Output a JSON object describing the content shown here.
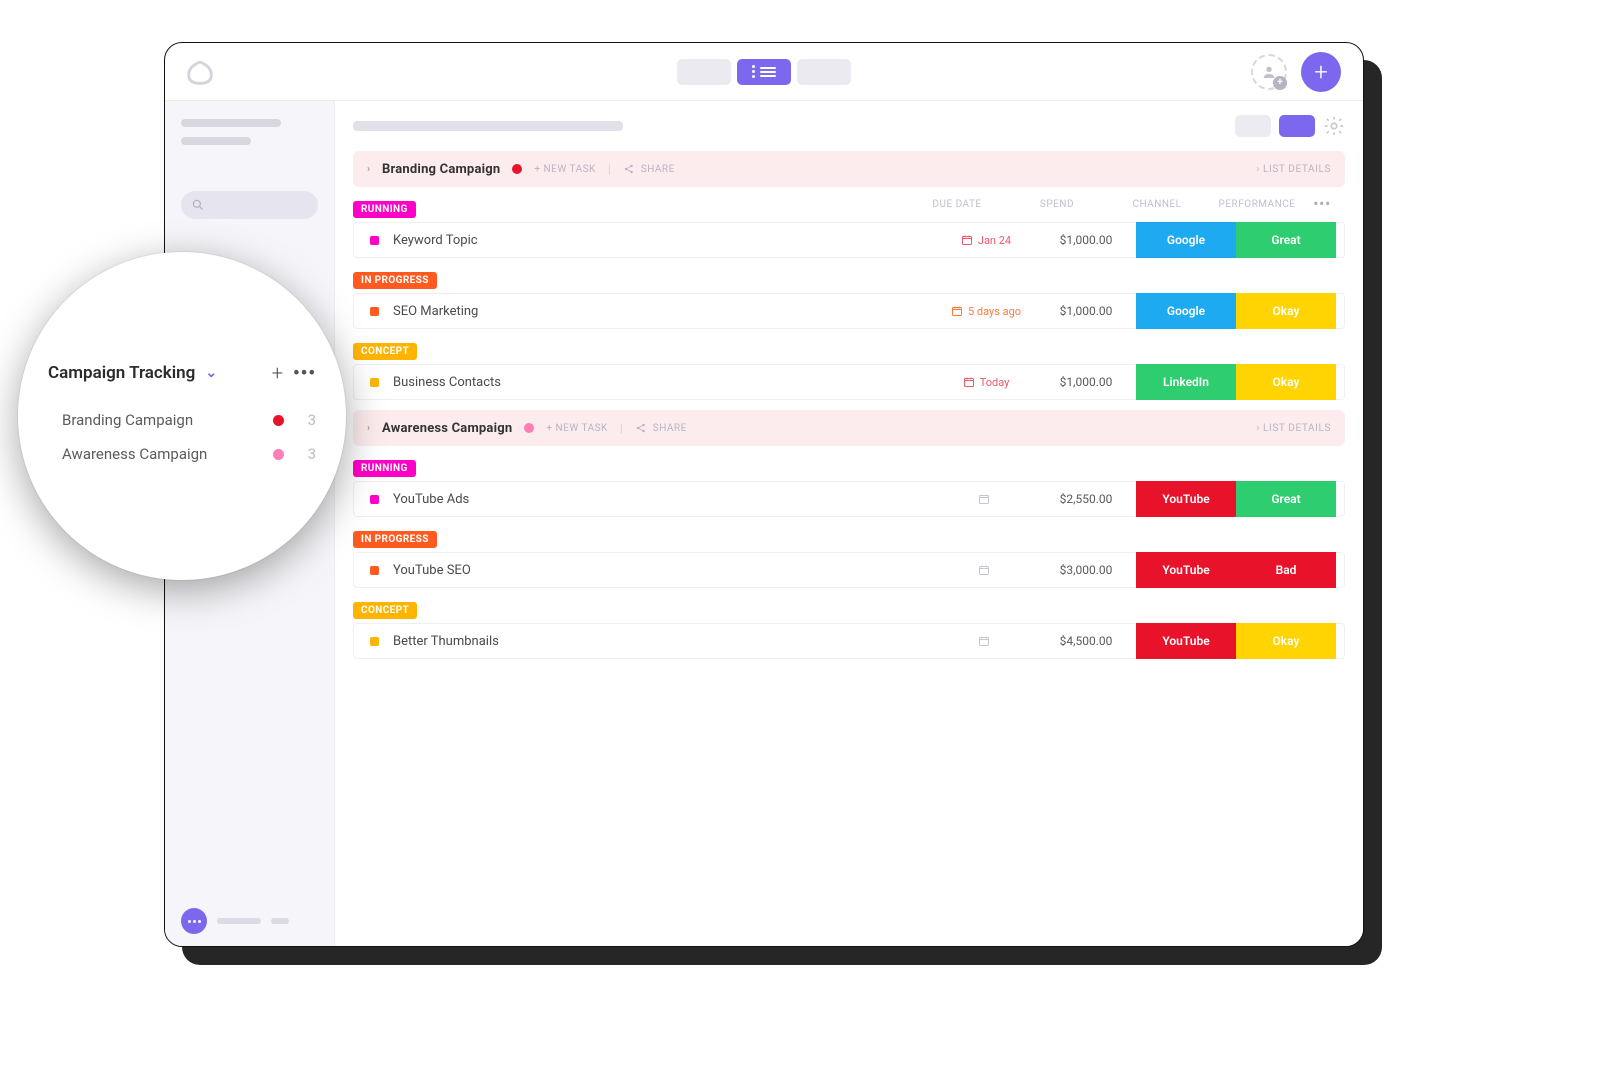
{
  "colors": {
    "accent": "#7b68ee",
    "magenta": "#ff00c7",
    "orange": "#ff5a1f",
    "amber": "#ffb400",
    "blue": "#1eaaf1",
    "green": "#2ecd6f",
    "yellow": "#ffd400",
    "red": "#e8132a",
    "pink": "#ff7eb6"
  },
  "zoom": {
    "title": "Campaign Tracking",
    "items": [
      {
        "label": "Branding Campaign",
        "dot_color": "#e8132a",
        "count": "3"
      },
      {
        "label": "Awareness Campaign",
        "dot_color": "#ff7eb6",
        "count": "3"
      }
    ]
  },
  "columns": {
    "due": "DUE DATE",
    "spend": "SPEND",
    "channel": "CHANNEL",
    "performance": "PERFORMANCE"
  },
  "group_actions": {
    "new_task": "+ NEW TASK",
    "share": "SHARE",
    "list_details": "LIST DETAILS"
  },
  "groups": [
    {
      "title": "Branding Campaign",
      "dot_color": "#e8132a",
      "header_bg": "pink-light",
      "show_column_headers": true,
      "sections": [
        {
          "status_label": "RUNNING",
          "status_color": "c-magenta",
          "tasks": [
            {
              "square_color": "c-magenta",
              "name": "Keyword Topic",
              "due_text": "Jan 24",
              "due_class": "due-red",
              "due_icon": true,
              "spend": "$1,000.00",
              "channel": "Google",
              "channel_color": "c-blue",
              "performance": "Great",
              "performance_color": "c-green"
            }
          ]
        },
        {
          "status_label": "IN PROGRESS",
          "status_color": "c-orange",
          "tasks": [
            {
              "square_color": "c-orange",
              "name": "SEO Marketing",
              "due_text": "5 days ago",
              "due_class": "due-orange",
              "due_icon": true,
              "spend": "$1,000.00",
              "channel": "Google",
              "channel_color": "c-blue",
              "performance": "Okay",
              "performance_color": "c-yellow"
            }
          ]
        },
        {
          "status_label": "CONCEPT",
          "status_color": "c-amber",
          "tasks": [
            {
              "square_color": "c-amber",
              "name": "Business Contacts",
              "due_text": "Today",
              "due_class": "due-red",
              "due_icon": true,
              "spend": "$1,000.00",
              "channel": "LinkedIn",
              "channel_color": "c-green",
              "performance": "Okay",
              "performance_color": "c-yellow"
            }
          ]
        }
      ]
    },
    {
      "title": "Awareness Campaign",
      "dot_color": "#ff7eb6",
      "header_bg": "pink-light",
      "show_column_headers": false,
      "sections": [
        {
          "status_label": "RUNNING",
          "status_color": "c-magenta",
          "tasks": [
            {
              "square_color": "c-magenta",
              "name": "YouTube Ads",
              "due_text": "",
              "due_class": "due-grey",
              "due_icon": true,
              "spend": "$2,550.00",
              "channel": "YouTube",
              "channel_color": "c-red",
              "performance": "Great",
              "performance_color": "c-green"
            }
          ]
        },
        {
          "status_label": "IN PROGRESS",
          "status_color": "c-orange",
          "tasks": [
            {
              "square_color": "c-orange",
              "name": "YouTube SEO",
              "due_text": "",
              "due_class": "due-grey",
              "due_icon": true,
              "spend": "$3,000.00",
              "channel": "YouTube",
              "channel_color": "c-red",
              "performance": "Bad",
              "performance_color": "c-red"
            }
          ]
        },
        {
          "status_label": "CONCEPT",
          "status_color": "c-amber",
          "tasks": [
            {
              "square_color": "c-amber",
              "name": "Better Thumbnails",
              "due_text": "",
              "due_class": "due-grey",
              "due_icon": true,
              "spend": "$4,500.00",
              "channel": "YouTube",
              "channel_color": "c-red",
              "performance": "Okay",
              "performance_color": "c-yellow"
            }
          ]
        }
      ]
    }
  ]
}
